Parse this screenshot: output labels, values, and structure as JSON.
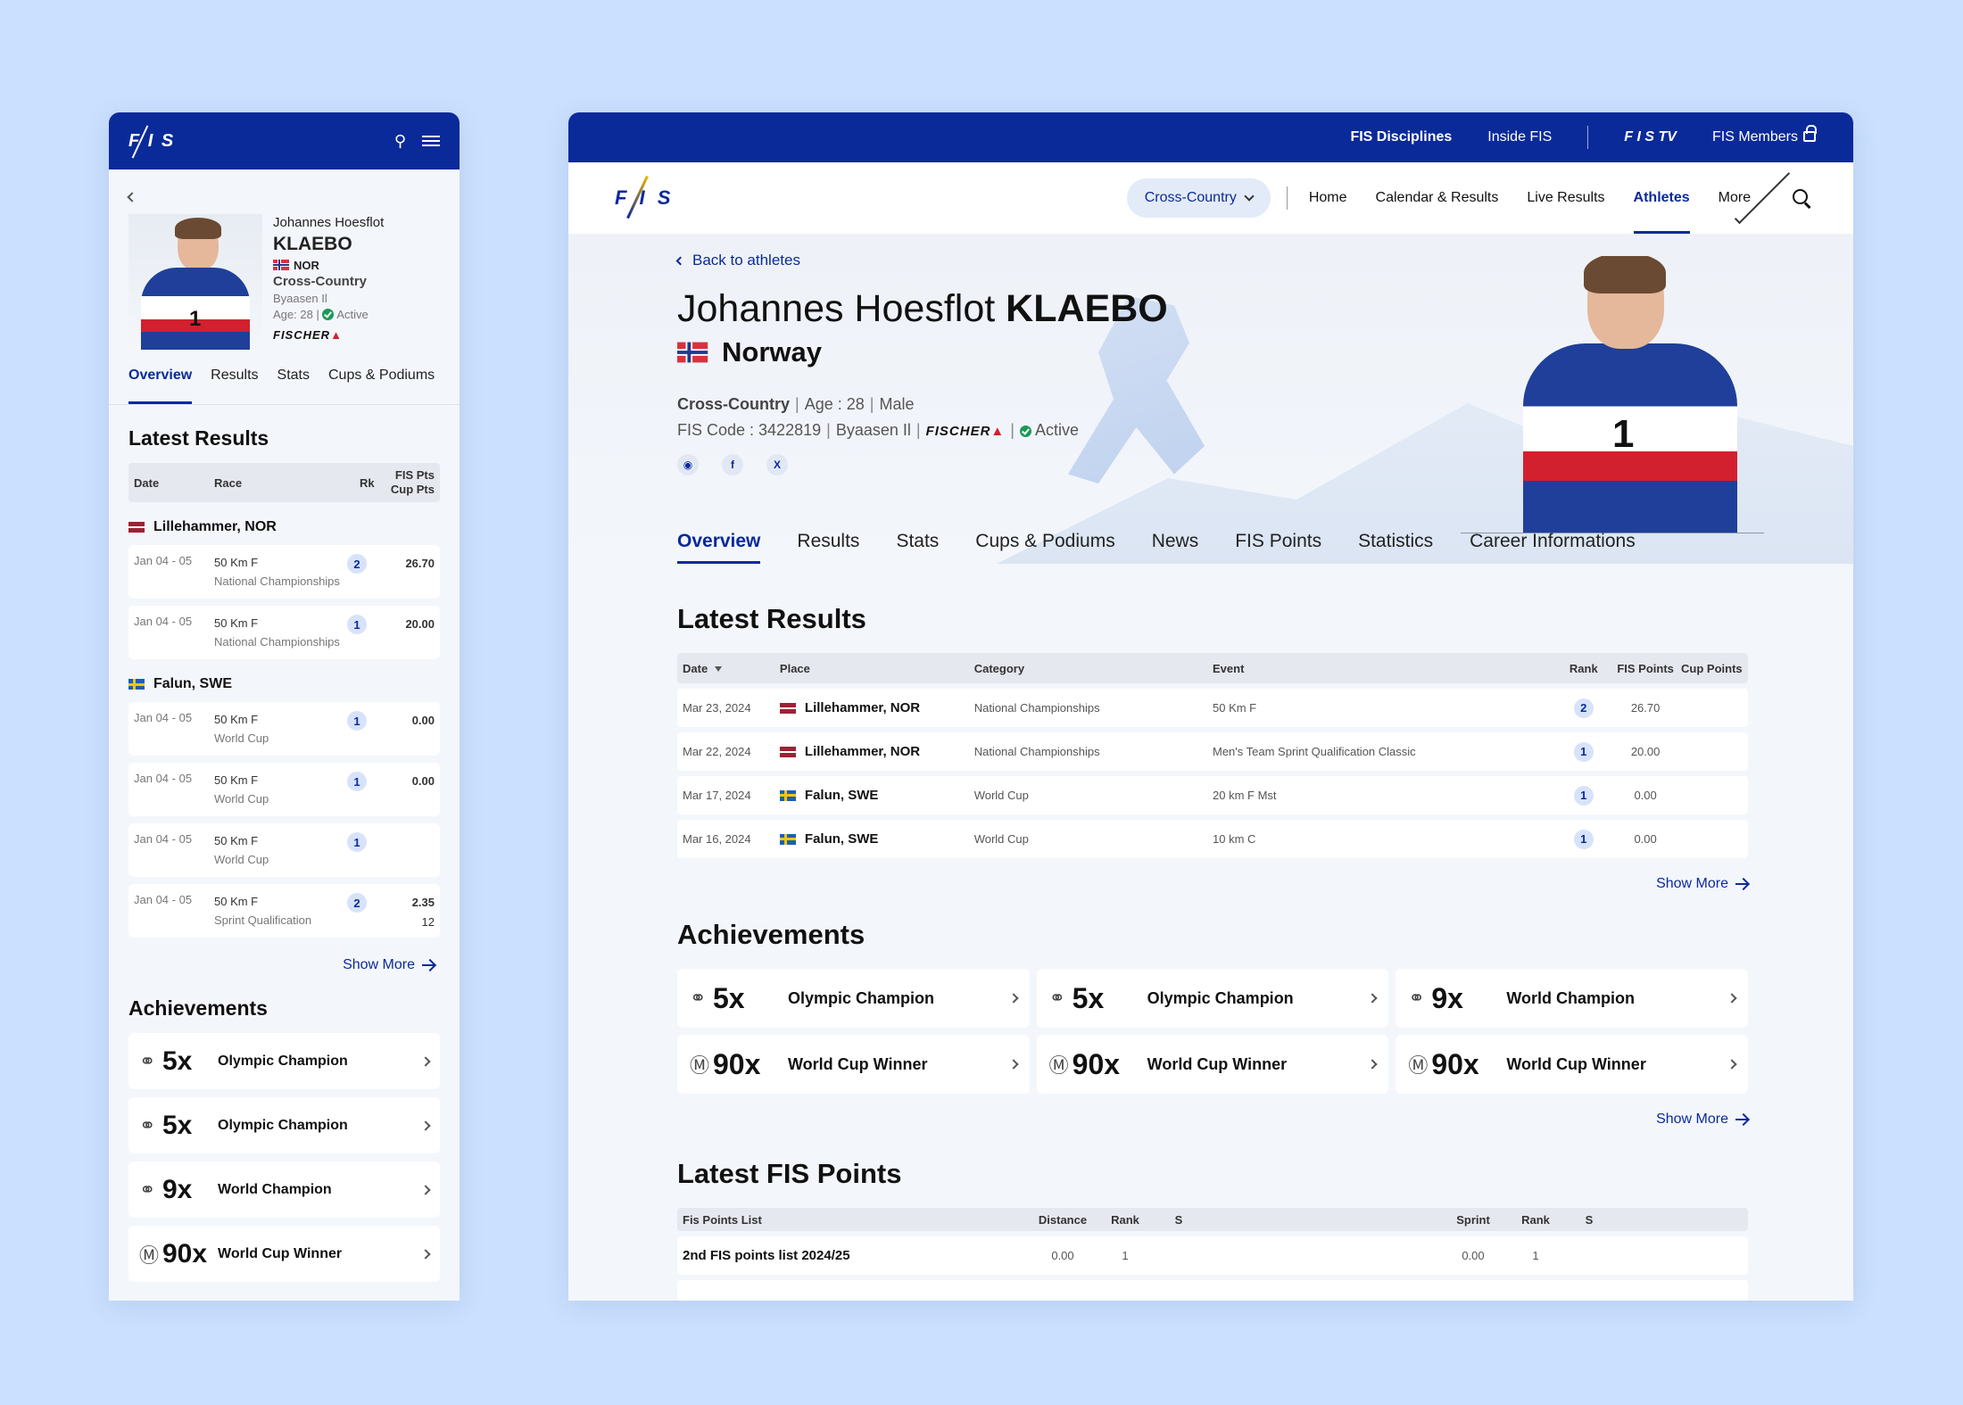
{
  "mobile": {
    "back_label": "",
    "athlete": {
      "first_name": "Johannes Hoesflot",
      "last_name": "KLAEBO",
      "country_code": "NOR",
      "discipline": "Cross-Country",
      "club": "Byaasen Il",
      "age": "Age: 28",
      "status": "Active",
      "sponsor": "FISCHER",
      "bib": "1"
    },
    "tabs": [
      "Overview",
      "Results",
      "Stats",
      "Cups & Podiums"
    ],
    "latest_results_title": "Latest Results",
    "table_headers": {
      "date": "Date",
      "race": "Race",
      "rk": "Rk",
      "fis_pts": "FIS Pts",
      "cup_pts": "Cup Pts"
    },
    "groups": [
      {
        "place": "Lillehammer, NOR",
        "flag": "lat",
        "results": [
          {
            "date": "Jan 04 - 05",
            "race": "50 Km F",
            "category": "National Championships",
            "rank": "2",
            "fis_pts": "26.70",
            "cup_pts": ""
          },
          {
            "date": "Jan 04 - 05",
            "race": "50 Km F",
            "category": "National Championships",
            "rank": "1",
            "fis_pts": "20.00",
            "cup_pts": ""
          }
        ]
      },
      {
        "place": "Falun, SWE",
        "flag": "swe",
        "results": [
          {
            "date": "Jan 04 - 05",
            "race": "50 Km F",
            "category": "World Cup",
            "rank": "1",
            "fis_pts": "0.00",
            "cup_pts": ""
          },
          {
            "date": "Jan 04 - 05",
            "race": "50 Km F",
            "category": "World Cup",
            "rank": "1",
            "fis_pts": "0.00",
            "cup_pts": ""
          },
          {
            "date": "Jan 04 - 05",
            "race": "50 Km F",
            "category": "World Cup",
            "rank": "1",
            "fis_pts": "",
            "cup_pts": ""
          },
          {
            "date": "Jan 04 - 05",
            "race": "50 Km F",
            "category": "Sprint Qualification",
            "rank": "2",
            "fis_pts": "2.35",
            "cup_pts": "12"
          }
        ]
      }
    ],
    "show_more": "Show More",
    "achievements_title": "Achievements",
    "achievements": [
      {
        "icon": "medal-icon",
        "count": "5x",
        "label": "Olympic Champion"
      },
      {
        "icon": "medal-icon",
        "count": "5x",
        "label": "Olympic Champion"
      },
      {
        "icon": "medal-icon",
        "count": "9x",
        "label": "World Champion"
      },
      {
        "icon": "trophy-icon",
        "count": "90x",
        "label": "World Cup Winner"
      }
    ]
  },
  "desktop": {
    "top_bar": {
      "disciplines": "FIS Disciplines",
      "inside": "Inside FIS",
      "tv": "TV",
      "members": "FIS Members"
    },
    "nav": {
      "discipline_select": "Cross-Country",
      "links": [
        "Home",
        "Calendar & Results",
        "Live Results",
        "Athletes",
        "More"
      ],
      "active": "Athletes"
    },
    "hero": {
      "back": "Back to athletes",
      "first_name": "Johannes Hoesflot",
      "last_name": "KLAEBO",
      "country": "Norway",
      "discipline": "Cross-Country",
      "age": "Age : 28",
      "gender": "Male",
      "fis_code": "FIS Code : 3422819",
      "club": "Byaasen Il",
      "sponsor": "FISCHER",
      "status": "Active",
      "bib": "1"
    },
    "tabs": [
      "Overview",
      "Results",
      "Stats",
      "Cups & Podiums",
      "News",
      "FIS Points",
      "Statistics",
      "Career Informations"
    ],
    "latest_results_title": "Latest  Results",
    "results_headers": {
      "date": "Date",
      "place": "Place",
      "category": "Category",
      "event": "Event",
      "rank": "Rank",
      "fis_points": "FIS Points",
      "cup_points": "Cup Points"
    },
    "results": [
      {
        "date": "Mar 23, 2024",
        "flag": "lat",
        "place": "Lillehammer, NOR",
        "category": "National Championships",
        "event": "50 Km F",
        "rank": "2",
        "fis_points": "26.70",
        "cup_points": ""
      },
      {
        "date": "Mar 22, 2024",
        "flag": "lat",
        "place": "Lillehammer, NOR",
        "category": "National Championships",
        "event": "Men's Team Sprint Qualification Classic",
        "rank": "1",
        "fis_points": "20.00",
        "cup_points": ""
      },
      {
        "date": "Mar 17, 2024",
        "flag": "swe",
        "place": "Falun, SWE",
        "category": "World Cup",
        "event": "20 km F Mst",
        "rank": "1",
        "fis_points": "0.00",
        "cup_points": ""
      },
      {
        "date": "Mar 16, 2024",
        "flag": "swe",
        "place": "Falun, SWE",
        "category": "World Cup",
        "event": "10 km C",
        "rank": "1",
        "fis_points": "0.00",
        "cup_points": ""
      }
    ],
    "show_more": "Show More",
    "achievements_title": "Achievements",
    "achievements": [
      {
        "icon": "medal-icon",
        "count": "5x",
        "label": "Olympic Champion"
      },
      {
        "icon": "medal-icon",
        "count": "5x",
        "label": "Olympic Champion"
      },
      {
        "icon": "medal-icon",
        "count": "9x",
        "label": "World Champion"
      },
      {
        "icon": "trophy-icon",
        "count": "90x",
        "label": "World Cup Winner"
      },
      {
        "icon": "trophy-icon",
        "count": "90x",
        "label": "World Cup Winner"
      },
      {
        "icon": "trophy-icon",
        "count": "90x",
        "label": "World Cup Winner"
      }
    ],
    "fis_points_title": "Latest  FIS Points",
    "fis_points_headers": {
      "list": "Fis Points List",
      "distance": "Distance",
      "rank": "Rank",
      "s": "S",
      "sprint": "Sprint",
      "rank2": "Rank",
      "s2": "S"
    },
    "fis_points_rows": [
      {
        "list": "2nd FIS points list 2024/25",
        "distance": "0.00",
        "rank": "1",
        "s": "",
        "sprint": "0.00",
        "rank2": "1",
        "s2": ""
      }
    ]
  },
  "colors": {
    "brand": "#0b2a9a",
    "background": "#cbe0fe",
    "active": "#1a9a56"
  }
}
